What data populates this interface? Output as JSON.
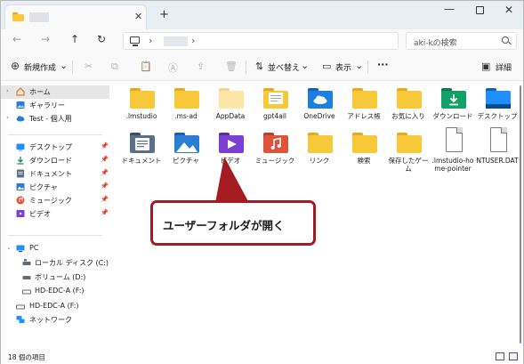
{
  "window": {
    "new_tab": "+",
    "min": "—",
    "close": "✕",
    "tab_close": "✕"
  },
  "nav": {
    "back": "←",
    "forward": "→",
    "up": "↑",
    "refresh": "↻",
    "chevron": "›"
  },
  "search": {
    "placeholder": "aki-kの検索"
  },
  "toolbar": {
    "new_label": "新規作成",
    "new_icon": "⊕",
    "chevron": "⌄",
    "sort_label": "並べ替え",
    "view_label": "表示",
    "more": "···",
    "details_label": "詳細"
  },
  "sidebar": {
    "items": [
      {
        "label": "ホーム",
        "icon": "home-icon",
        "color": "#e67e22"
      },
      {
        "label": "ギャラリー",
        "icon": "gallery-icon",
        "color": "#2a7fd4"
      },
      {
        "label": "Test - 個人用",
        "icon": "cloud-icon",
        "color": "#2a7fd4"
      },
      {
        "label": "デスクトップ",
        "icon": "desktop-icon",
        "color": "#1e90ff"
      },
      {
        "label": "ダウンロード",
        "icon": "download-icon",
        "color": "#1a8a5a"
      },
      {
        "label": "ドキュメント",
        "icon": "documents-icon",
        "color": "#5a6f8a"
      },
      {
        "label": "ピクチャ",
        "icon": "pictures-icon",
        "color": "#2a7fd4"
      },
      {
        "label": "ミュージック",
        "icon": "music-icon",
        "color": "#e0533a"
      },
      {
        "label": "ビデオ",
        "icon": "videos-icon",
        "color": "#7b3fd4"
      },
      {
        "label": "PC",
        "icon": "pc-icon",
        "color": "#1e90ff"
      },
      {
        "label": "ローカル ディスク (C:)",
        "icon": "drive-icon",
        "color": "#6a6a6a"
      },
      {
        "label": "ボリューム (D:)",
        "icon": "drive-icon",
        "color": "#6a6a6a"
      },
      {
        "label": "HD-EDC-A (F:)",
        "icon": "drive-icon",
        "color": "#6a6a6a"
      },
      {
        "label": "HD-EDC-A (F:)",
        "icon": "drive-icon",
        "color": "#6a6a6a"
      },
      {
        "label": "ネットワーク",
        "icon": "network-icon",
        "color": "#1e90ff"
      }
    ],
    "pin": "📌"
  },
  "files": [
    {
      "name": ".lmstudio",
      "type": "folder"
    },
    {
      "name": ".ms-ad",
      "type": "folder"
    },
    {
      "name": "AppData",
      "type": "folder-light"
    },
    {
      "name": "gpt4all",
      "type": "folder-doc"
    },
    {
      "name": "OneDrive",
      "type": "folder-onedrive"
    },
    {
      "name": "アドレス帳",
      "type": "folder"
    },
    {
      "name": "お気に入り",
      "type": "folder"
    },
    {
      "name": "ダウンロード",
      "type": "folder-download"
    },
    {
      "name": "デスクトップ",
      "type": "folder-desktop"
    },
    {
      "name": "ドキュメント",
      "type": "folder-documents"
    },
    {
      "name": "ピクチャ",
      "type": "folder-pictures"
    },
    {
      "name": "ビデオ",
      "type": "folder-videos"
    },
    {
      "name": "ミュージック",
      "type": "folder-music"
    },
    {
      "name": "リンク",
      "type": "folder"
    },
    {
      "name": "検索",
      "type": "folder"
    },
    {
      "name": "保存したゲーム",
      "type": "folder"
    },
    {
      "name": ".lmstudio-home-pointer",
      "type": "file"
    },
    {
      "name": "NTUSER.DAT",
      "type": "file"
    }
  ],
  "callout": {
    "text": "ユーザーフォルダが開く"
  },
  "status": {
    "count": "18 個の項目"
  },
  "colors": {
    "accent": "#a41c22",
    "folder": "#f8c83b",
    "folder_dark": "#e9a91a"
  }
}
